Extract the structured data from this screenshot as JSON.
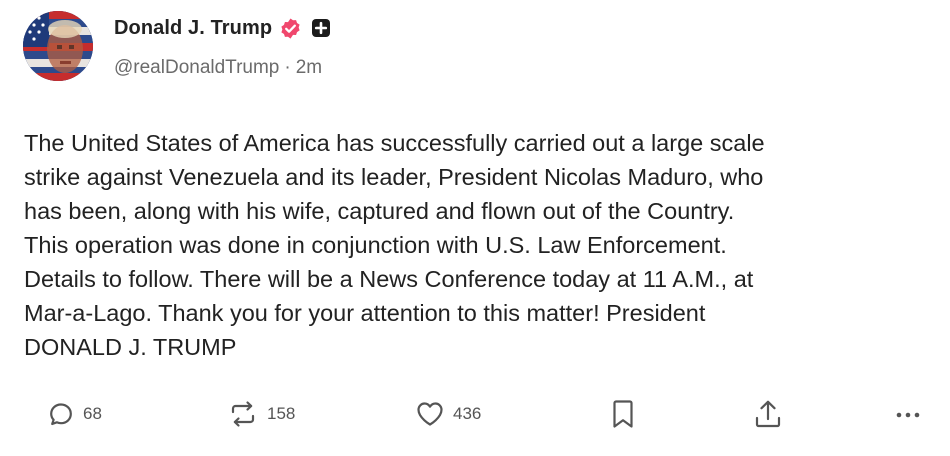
{
  "post": {
    "author": {
      "display_name": "Donald J. Trump",
      "handle": "@realDonaldTrump",
      "separator": "·",
      "time_ago": "2m",
      "avatar_icon": "flag-portrait-avatar",
      "verified_icon": "verified-badge-icon",
      "verified_color": "#f0476d",
      "plus_icon": "plus-badge-icon"
    },
    "body": "The United States of America has successfully carried out a large scale\nstrike against Venezuela and its leader, President Nicolas Maduro, who\nhas been, along with his wife, captured and flown out of the Country.\nThis operation was done in conjunction with U.S. Law Enforcement.\nDetails to follow. There will be a News Conference today at 11 A.M., at\nMar-a-Lago. Thank you for your attention to this matter! President\nDONALD J. TRUMP",
    "actions": {
      "reply": {
        "icon": "reply-icon",
        "count": "68"
      },
      "repost": {
        "icon": "repost-icon",
        "count": "158"
      },
      "like": {
        "icon": "heart-icon",
        "count": "436"
      },
      "bookmark": {
        "icon": "bookmark-icon"
      },
      "share": {
        "icon": "share-icon"
      },
      "more": {
        "icon": "more-options-icon"
      }
    }
  }
}
